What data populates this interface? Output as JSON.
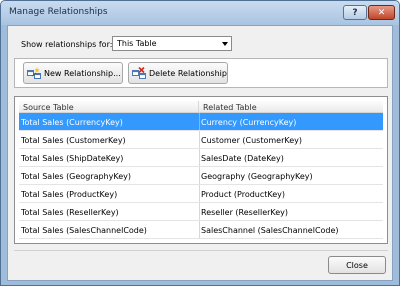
{
  "window": {
    "title": "Manage Relationships",
    "help_label": "?",
    "close_glyph": "✕"
  },
  "filter": {
    "label": "Show relationships for:",
    "selected": "This Table"
  },
  "toolbar": {
    "new_label": "New Relationship...",
    "delete_label": "Delete Relationship",
    "new_icon": "new-relationship-icon",
    "delete_icon": "delete-relationship-icon"
  },
  "grid": {
    "headers": {
      "source": "Source Table",
      "related": "Related Table"
    },
    "selected_row_color": "#3399ff",
    "rows": [
      {
        "source": "Total Sales (CurrencyKey)",
        "related": "Currency (CurrencyKey)"
      },
      {
        "source": "Total Sales (CustomerKey)",
        "related": "Customer (CustomerKey)"
      },
      {
        "source": "Total Sales (ShipDateKey)",
        "related": "SalesDate (DateKey)"
      },
      {
        "source": "Total Sales (GeographyKey)",
        "related": "Geography (GeographyKey)"
      },
      {
        "source": "Total Sales (ProductKey)",
        "related": "Product (ProductKey)"
      },
      {
        "source": "Total Sales (ResellerKey)",
        "related": "Reseller (ResellerKey)"
      },
      {
        "source": "Total Sales (SalesChannelCode)",
        "related": "SalesChannel (SalesChannelCode)"
      }
    ]
  },
  "footer": {
    "close_label": "Close"
  }
}
